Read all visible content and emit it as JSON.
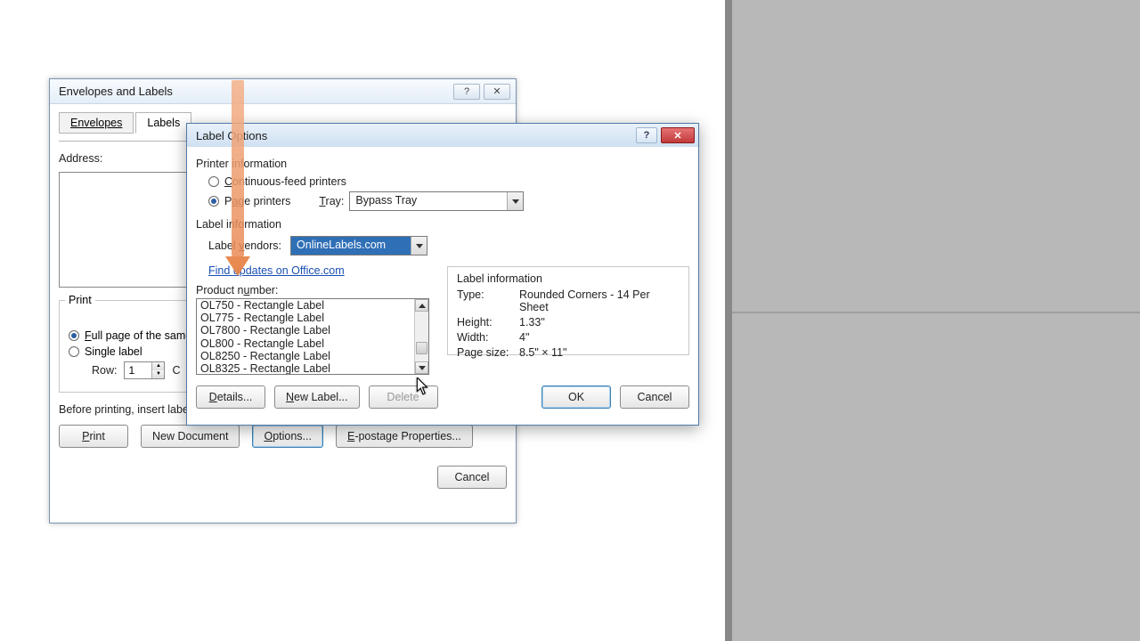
{
  "dlg1": {
    "title": "Envelopes and Labels",
    "tabs": {
      "envelopes": "Envelopes",
      "labels": "Labels"
    },
    "address_label": "Address:",
    "print_legend": "Print",
    "full_page": "Full page of the same label",
    "single_label": "Single label",
    "row_label": "Row:",
    "row_value": "1",
    "hint": "Before printing, insert labels in your printer's manual feeder.",
    "buttons": {
      "print": "Print",
      "new_document": "New Document",
      "options": "Options...",
      "epostage": "E-postage Properties...",
      "cancel": "Cancel"
    }
  },
  "dlg2": {
    "title": "Label Options",
    "printer_info": "Printer information",
    "continuous": "Continuous-feed printers",
    "page_printers": "Page printers",
    "tray_label": "Tray:",
    "tray_value": "Bypass Tray",
    "label_info_section": "Label information",
    "vendors_label": "Label vendors:",
    "vendors_value": "OnlineLabels.com",
    "find_updates": "Find updates on Office.com",
    "product_label": "Product number:",
    "products": [
      "OL750 - Rectangle Label",
      "OL775 - Rectangle Label",
      "OL7800 - Rectangle Label",
      "OL800 - Rectangle Label",
      "OL8250 - Rectangle Label",
      "OL8325 - Rectangle Label"
    ],
    "info_title": "Label information",
    "info": {
      "type_k": "Type:",
      "type_v": "Rounded Corners - 14 Per Sheet",
      "height_k": "Height:",
      "height_v": "1.33\"",
      "width_k": "Width:",
      "width_v": "4\"",
      "page_k": "Page size:",
      "page_v": "8.5\" × 11\""
    },
    "buttons": {
      "details": "Details...",
      "new_label": "New Label...",
      "delete": "Delete",
      "ok": "OK",
      "cancel": "Cancel"
    }
  }
}
